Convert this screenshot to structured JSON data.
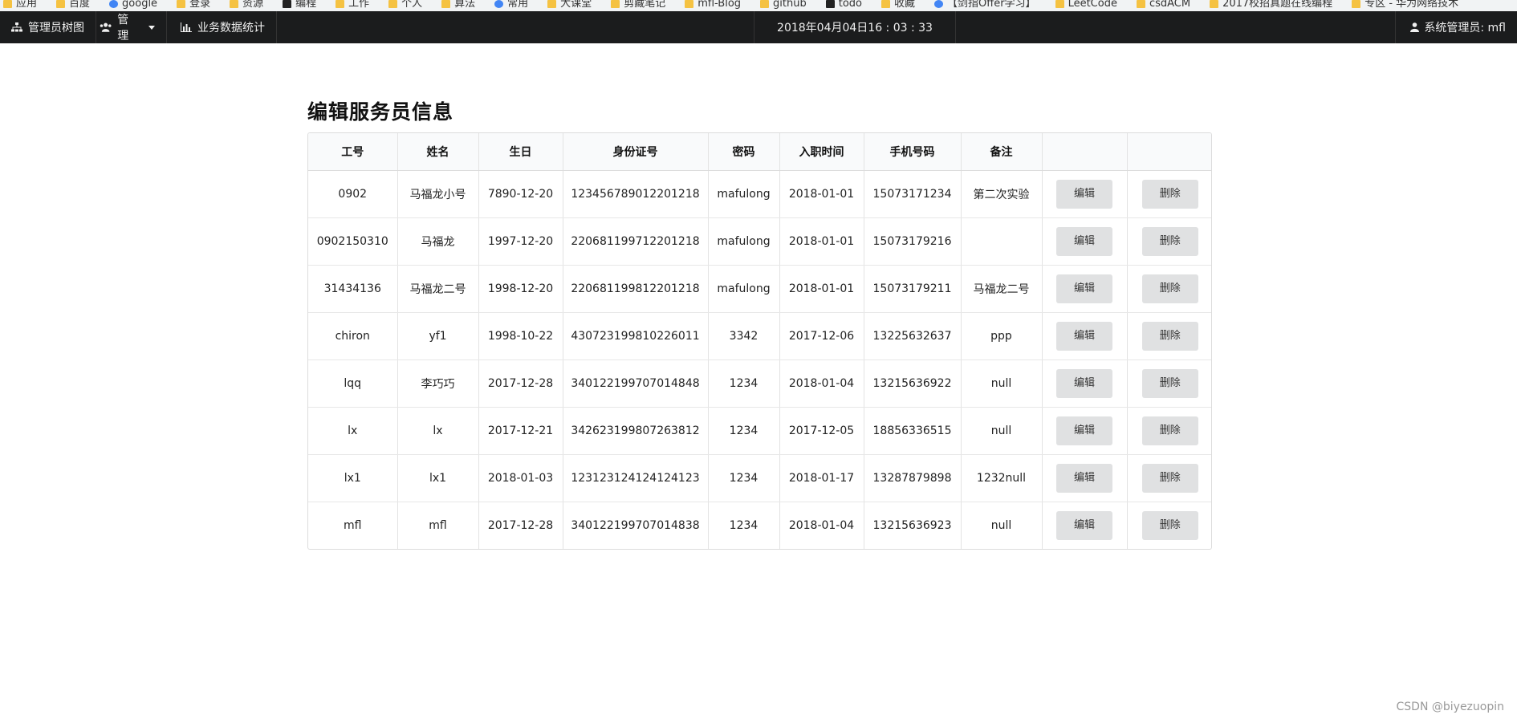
{
  "bookmarks": [
    "应用",
    "百度",
    "google",
    "登录",
    "资源",
    "编程",
    "工作",
    "个人",
    "算法",
    "常用",
    "大课堂",
    "剪藏笔记",
    "mfl-Blog",
    "github",
    "todo",
    "收藏",
    "【剑指Offer学习】",
    "LeetCode",
    "csdACM",
    "2017校招真题在线编程",
    "专区 - 华为网络技术"
  ],
  "navbar": {
    "tree_label": "管理员树图",
    "manage_label": "管理",
    "stats_label": "业务数据统计",
    "datetime": "2018年04月04日16 : 03 : 33",
    "user_label": "系统管理员: mfl"
  },
  "page": {
    "title": "编辑服务员信息"
  },
  "table": {
    "headers": [
      "工号",
      "姓名",
      "生日",
      "身份证号",
      "密码",
      "入职时间",
      "手机号码",
      "备注",
      "",
      ""
    ],
    "edit_label": "编辑",
    "delete_label": "删除",
    "rows": [
      [
        "0902",
        "马福龙小号",
        "7890-12-20",
        "123456789012201218",
        "mafulong",
        "2018-01-01",
        "15073171234",
        "第二次实验"
      ],
      [
        "0902150310",
        "马福龙",
        "1997-12-20",
        "220681199712201218",
        "mafulong",
        "2018-01-01",
        "15073179216",
        ""
      ],
      [
        "31434136",
        "马福龙二号",
        "1998-12-20",
        "220681199812201218",
        "mafulong",
        "2018-01-01",
        "15073179211",
        "马福龙二号"
      ],
      [
        "chiron",
        "yf1",
        "1998-10-22",
        "430723199810226011",
        "3342",
        "2017-12-06",
        "13225632637",
        "ppp"
      ],
      [
        "lqq",
        "李巧巧",
        "2017-12-28",
        "340122199707014848",
        "1234",
        "2018-01-04",
        "13215636922",
        "null"
      ],
      [
        "lx",
        "lx",
        "2017-12-21",
        "342623199807263812",
        "1234",
        "2017-12-05",
        "18856336515",
        "null"
      ],
      [
        "lx1",
        "lx1",
        "2018-01-03",
        "123123124124124123",
        "1234",
        "2018-01-17",
        "13287879898",
        "1232null"
      ],
      [
        "mfl",
        "mfl",
        "2017-12-28",
        "340122199707014838",
        "1234",
        "2018-01-04",
        "13215636923",
        "null"
      ]
    ]
  },
  "watermark": "CSDN @biyezuopin"
}
